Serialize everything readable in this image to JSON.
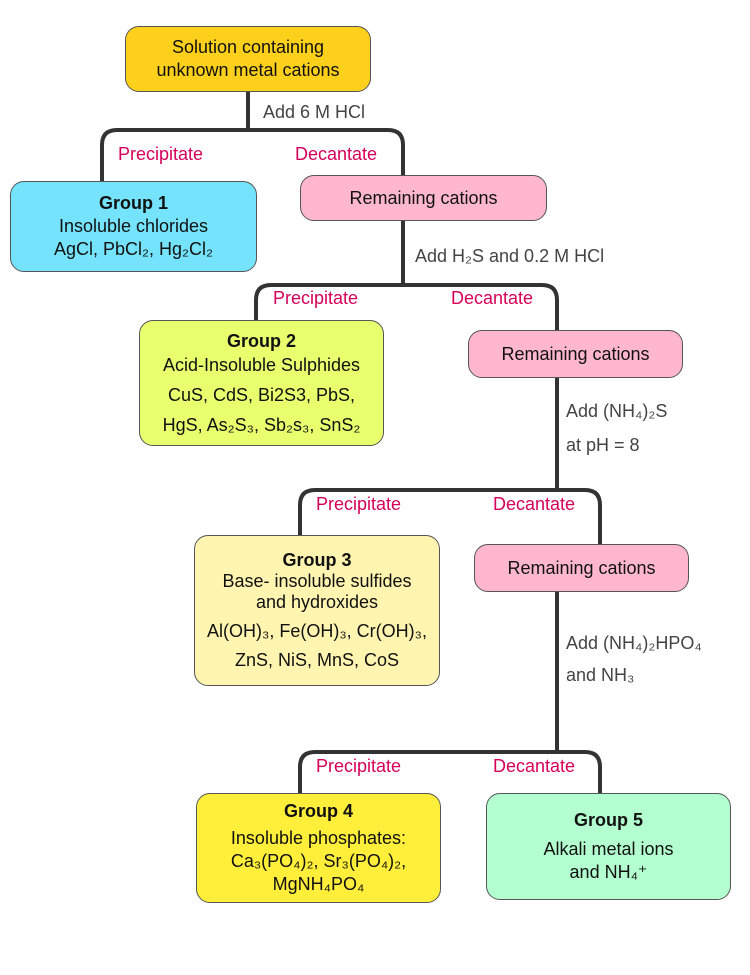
{
  "start": {
    "lines": [
      "Solution containing",
      "unknown metal cations"
    ],
    "color": "#FDD01C"
  },
  "steps": [
    {
      "reagent": [
        "Add 6 M HCl"
      ],
      "precipitate": "Precipitate",
      "decantate": "Decantate"
    },
    {
      "reagent": [
        "Add H₂S and 0.2 M HCl"
      ],
      "precipitate": "Precipitate",
      "decantate": "Decantate"
    },
    {
      "reagent": [
        "Add (NH₄)₂S",
        "at pH = 8"
      ],
      "precipitate": "Precipitate",
      "decantate": "Decantate"
    },
    {
      "reagent": [
        "Add (NH₄)₂HPO₄",
        "and NH₃"
      ],
      "precipitate": "Precipitate",
      "decantate": "Decantate"
    }
  ],
  "remaining": {
    "label": "Remaining cations",
    "color": "#FFB6CF"
  },
  "groups": [
    {
      "title": "Group 1",
      "lines": [
        "Insoluble chlorides",
        "AgCl, PbCl₂, Hg₂Cl₂"
      ],
      "color": "#74E3FB"
    },
    {
      "title": "Group 2",
      "lines": [
        "Acid-Insoluble Sulphides",
        "CuS, CdS, Bi2S3, PbS,",
        "HgS, As₂S₃, Sb₂s₃, SnS₂"
      ],
      "color": "#E8FF6E"
    },
    {
      "title": "Group 3",
      "lines": [
        "Base- insoluble sulfides",
        "and hydroxides",
        "Al(OH)₃, Fe(OH)₃, Cr(OH)₃,",
        "ZnS, NiS, MnS, CoS"
      ],
      "color": "#FFF5B0"
    },
    {
      "title": "Group 4",
      "lines": [
        "Insoluble phosphates:",
        "Ca₃(PO₄)₂, Sr₃(PO₄)₂,",
        "MgNH₄PO₄"
      ],
      "color": "#FFEF3A"
    },
    {
      "title": "Group 5",
      "lines": [
        "Alkali metal ions",
        "and NH₄⁺"
      ],
      "color": "#B3FFD0"
    }
  ],
  "line_color": "#333333",
  "label_color": "#D6005A"
}
